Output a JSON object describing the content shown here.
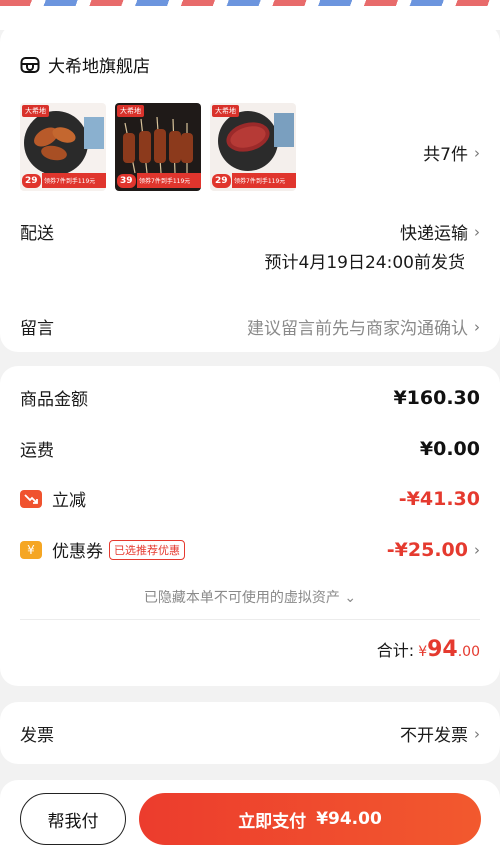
{
  "shop": {
    "name": "大希地旗舰店",
    "icon": "store-icon"
  },
  "items": {
    "count_label": "共7件",
    "thumbs": [
      {
        "brand": "大希地",
        "price": "29",
        "promo": "领券7件到手119元"
      },
      {
        "brand": "大希地",
        "price": "39",
        "promo": "领券7件到手119元"
      },
      {
        "brand": "大希地",
        "price": "29",
        "promo": "领券7件到手119元"
      }
    ]
  },
  "delivery": {
    "label": "配送",
    "method": "快递运输",
    "estimate": "预计4月19日24:00前发货"
  },
  "message": {
    "label": "留言",
    "placeholder": "建议留言前先与商家沟通确认"
  },
  "summary": {
    "goods_label": "商品金额",
    "goods_value": "¥160.30",
    "shipping_label": "运费",
    "shipping_value": "¥0.00",
    "discount_label": "立减",
    "discount_value": "-¥41.30",
    "coupon_label": "优惠券",
    "coupon_tag": "已选推荐优惠",
    "coupon_value": "-¥25.00",
    "hidden_note": "已隐藏本单不可使用的虚拟资产",
    "total_label": "合计:",
    "total_symbol": "¥",
    "total_int": "94",
    "total_dec": ".00"
  },
  "invoice": {
    "label": "发票",
    "value": "不开发票"
  },
  "actions": {
    "help_pay": "帮我付",
    "pay_label": "立即支付",
    "pay_amount": "¥94.00"
  },
  "colors": {
    "accent": "#e53a2f",
    "discount_badge": "#f0522e",
    "coupon_badge": "#f5a623"
  }
}
